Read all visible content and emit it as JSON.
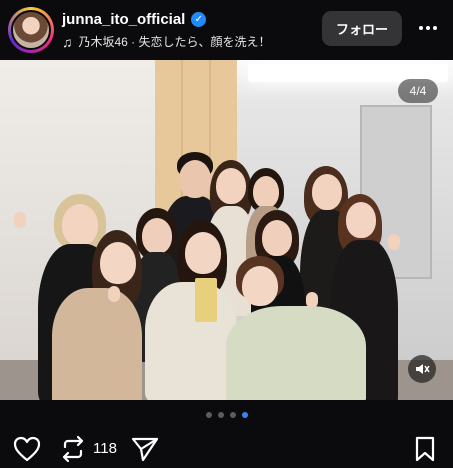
{
  "post": {
    "username": "junna_ito_official",
    "verified_mark": "✓",
    "music": "乃木坂46 · 失恋したら、顔を洗え！",
    "follow_label": "フォロー",
    "slide_counter": "4/4",
    "repost_count": "118"
  },
  "carousel": {
    "total": 4,
    "active": 4
  },
  "icons": {
    "verified": "verified-badge-icon",
    "music": "music-note-icon",
    "more": "more-options-icon",
    "mute": "muted-speaker-icon",
    "like": "heart-icon",
    "repost": "repost-icon",
    "share": "send-icon",
    "save": "bookmark-icon"
  },
  "colors": {
    "background": "#0b0b0d",
    "accent": "#3b82f6",
    "verified": "#1f8bff"
  }
}
